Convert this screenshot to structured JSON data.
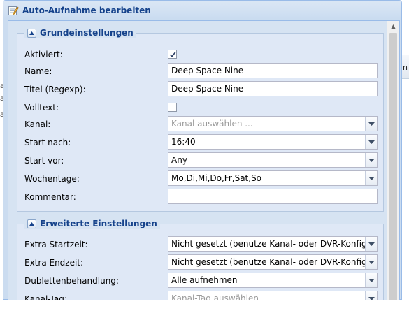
{
  "window": {
    "title": "Auto-Aufnahme bearbeiten"
  },
  "background": {
    "left_fragments": [
      "a",
      "a",
      "a"
    ],
    "right_fragment": "n"
  },
  "sections": {
    "basic": {
      "title": "Grundeinstellungen",
      "fields": {
        "enabled": {
          "label": "Aktiviert:",
          "checked": true
        },
        "name": {
          "label": "Name:",
          "value": "Deep Space Nine"
        },
        "title": {
          "label": "Titel (Regexp):",
          "value": "Deep Space Nine"
        },
        "fulltext": {
          "label": "Volltext:",
          "checked": false
        },
        "channel": {
          "label": "Kanal:",
          "placeholder": "Kanal auswählen ..."
        },
        "start_after": {
          "label": "Start nach:",
          "value": "16:40"
        },
        "start_before": {
          "label": "Start vor:",
          "value": "Any"
        },
        "weekdays": {
          "label": "Wochentage:",
          "value": "Mo,Di,Mi,Do,Fr,Sat,So"
        },
        "comment": {
          "label": "Kommentar:",
          "value": ""
        }
      }
    },
    "advanced": {
      "title": "Erweiterte Einstellungen",
      "fields": {
        "extra_start": {
          "label": "Extra Startzeit:",
          "value": "Nicht gesetzt (benutze Kanal- oder DVR-Konfiguration)"
        },
        "extra_end": {
          "label": "Extra Endzeit:",
          "value": "Nicht gesetzt (benutze Kanal- oder DVR-Konfiguration)"
        },
        "duplicate": {
          "label": "Dublettenbehandlung:",
          "value": "Alle aufnehmen"
        },
        "channel_tag": {
          "label": "Kanal-Tag:",
          "placeholder": "Kanal-Tag auswählen"
        }
      }
    }
  },
  "icons": {
    "title": "edit-note-icon",
    "collapse": "chevron-up-icon",
    "combo": "chevron-down-icon",
    "check": "checkmark-icon"
  },
  "colors": {
    "header_text": "#15428b",
    "window_frame": "#99bbe8",
    "panel_bg": "#d6e3f2",
    "field_border": "#b5b8c8",
    "disabled_text": "#9a9a9a"
  }
}
